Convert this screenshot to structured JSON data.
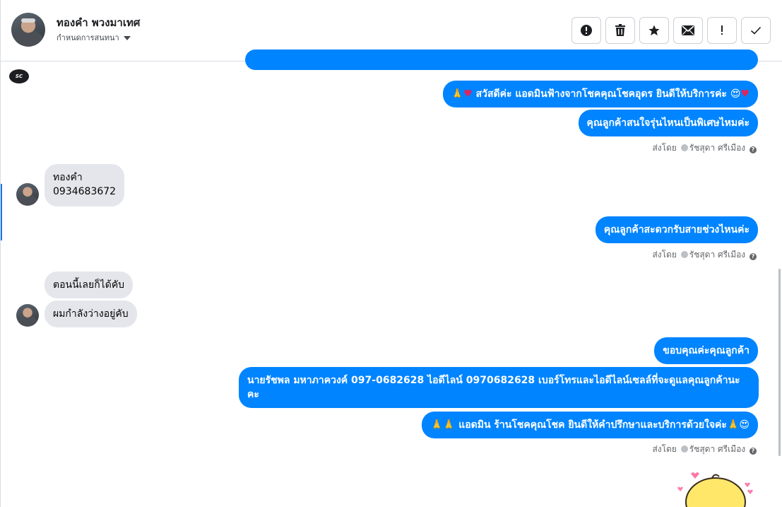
{
  "header": {
    "contact_name": "ทองคำ พวงมาเทศ",
    "subtitle": "กำหนดการสนทนา"
  },
  "toolbar": {
    "buttons": [
      "alert-circle-icon",
      "trash-icon",
      "star-icon",
      "envelope-icon",
      "exclamation-icon",
      "check-icon"
    ]
  },
  "messages": {
    "greeting_text": "สวัสดีค่ะ แอดมินฟ้างจากโชคคุณโชคอุดร ยินดีให้บริการค่ะ",
    "ask_model": "คุณลูกค้าสนใจรุ่นไหนเป็นพิเศษไหมค่ะ",
    "incoming_name": "ทองคำ",
    "incoming_phone": "0934683672",
    "ask_time": "คุณลูกค้าสะดวกรับสายช่วงไหนค่ะ",
    "reply_now": "ตอนนี้เลยก็ได้คับ",
    "reply_free": "ผมกำลังว่างอยู่คับ",
    "thanks": "ขอบคุณค่ะคุณลูกค้า",
    "contact_info": "นายรัชพล มหาภาควงค์  097-0682628 ไอดีไลน์ 0970682628  เบอร์โทรและไอดีไลน์เซลล์ที่จะดูแลคุณลูกค้านะคะ",
    "closing_text": "แอดมิน ร้านโชคคุณโชค ยินดีให้คำปรึกษาและบริการด้วยใจค่ะ"
  },
  "meta": {
    "sent_by_label": "ส่งโดย",
    "sender_name": "รัชสุดา ศรีเมือง",
    "help_glyph": "?"
  },
  "logo_text": "SC",
  "colors": {
    "outgoing_bubble": "#0084ff",
    "incoming_bubble": "#e4e6eb",
    "accent": "#1877f2"
  }
}
